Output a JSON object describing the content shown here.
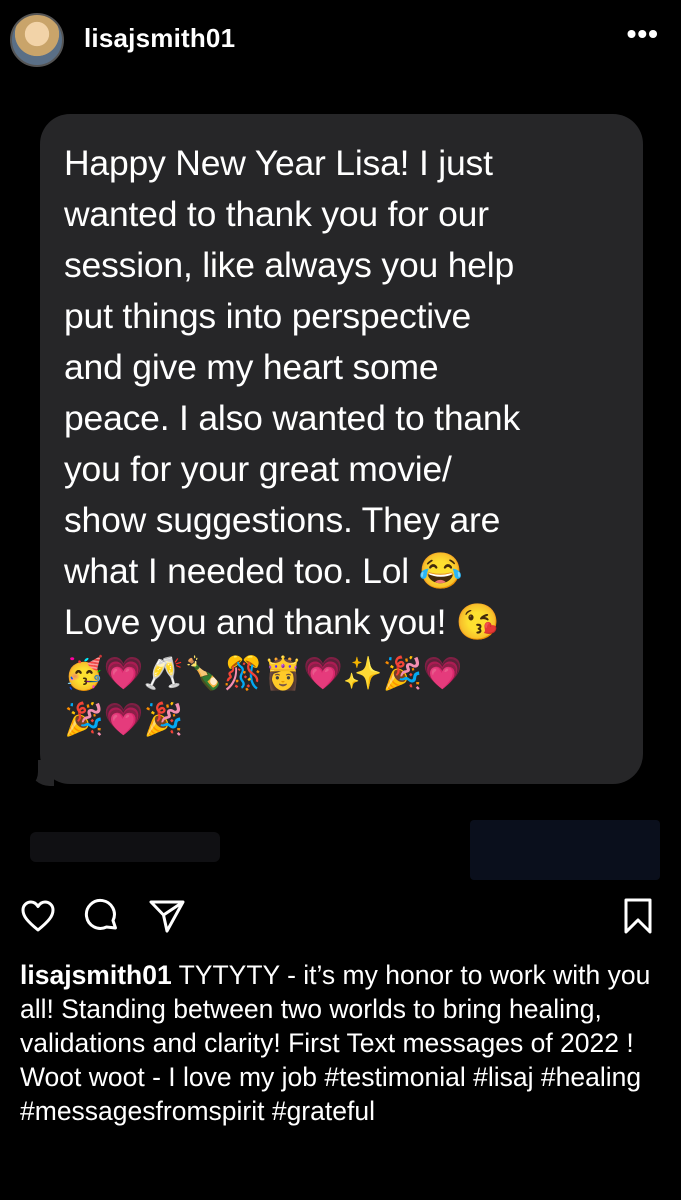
{
  "header": {
    "username": "lisajsmith01",
    "more_icon": "more-dots-icon",
    "more_label": "•••"
  },
  "post": {
    "message": "Happy New Year Lisa! I just\nwanted to thank you for our\nsession, like always you help\nput things into perspective\nand  give my heart some\npeace. I also wanted to thank\nyou for your great movie/\nshow suggestions. They are\nwhat I needed too. Lol 😂\nLove you and thank you! 😘",
    "emoji_row_1": "🥳💗🥂🍾🎊👸💗✨🎉💗",
    "emoji_row_2": "🎉💗🎉"
  },
  "actions": {
    "like_icon": "heart-icon",
    "comment_icon": "comment-icon",
    "share_icon": "send-icon",
    "save_icon": "bookmark-icon"
  },
  "caption": {
    "username": "lisajsmith01",
    "text": " TYTYTY - it’s my honor to work with you all!  Standing between two worlds to bring healing, validations and clarity!  First Text messages of 2022 !  Woot woot - I love my job #testimonial #lisaj #healing #messagesfromspirit #grateful"
  }
}
